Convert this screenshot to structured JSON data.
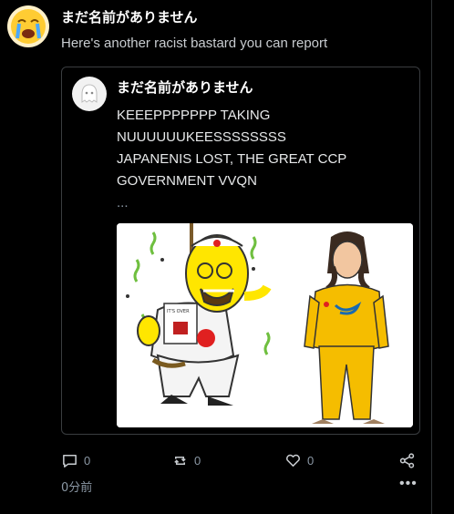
{
  "post": {
    "author_name": "まだ名前がありません",
    "avatar_icon": "crying-face-emoji",
    "text": "Here's another racist bastard you can report",
    "quoted": {
      "author_name": "まだ名前がありません",
      "avatar_icon": "default-ghost-avatar",
      "lines": [
        "KEEEPPPPPPP TAKING",
        "NUUUUUUKEESSSSSSSS",
        "JAPANENIS LOST, THE GREAT CCP",
        "GOVERNMENT VVQN"
      ],
      "ellipsis": "...",
      "image": {
        "description_icon": "meme-illustration",
        "sign_text": "IT'S OVER"
      }
    },
    "actions": {
      "reply_count": "0",
      "repost_count": "0",
      "like_count": "0"
    },
    "timestamp": "0分前",
    "more_label": "•••"
  },
  "colors": {
    "background": "#000000",
    "text": "#e7e9ea",
    "muted": "#8b98a5",
    "border": "#3a3d40"
  }
}
